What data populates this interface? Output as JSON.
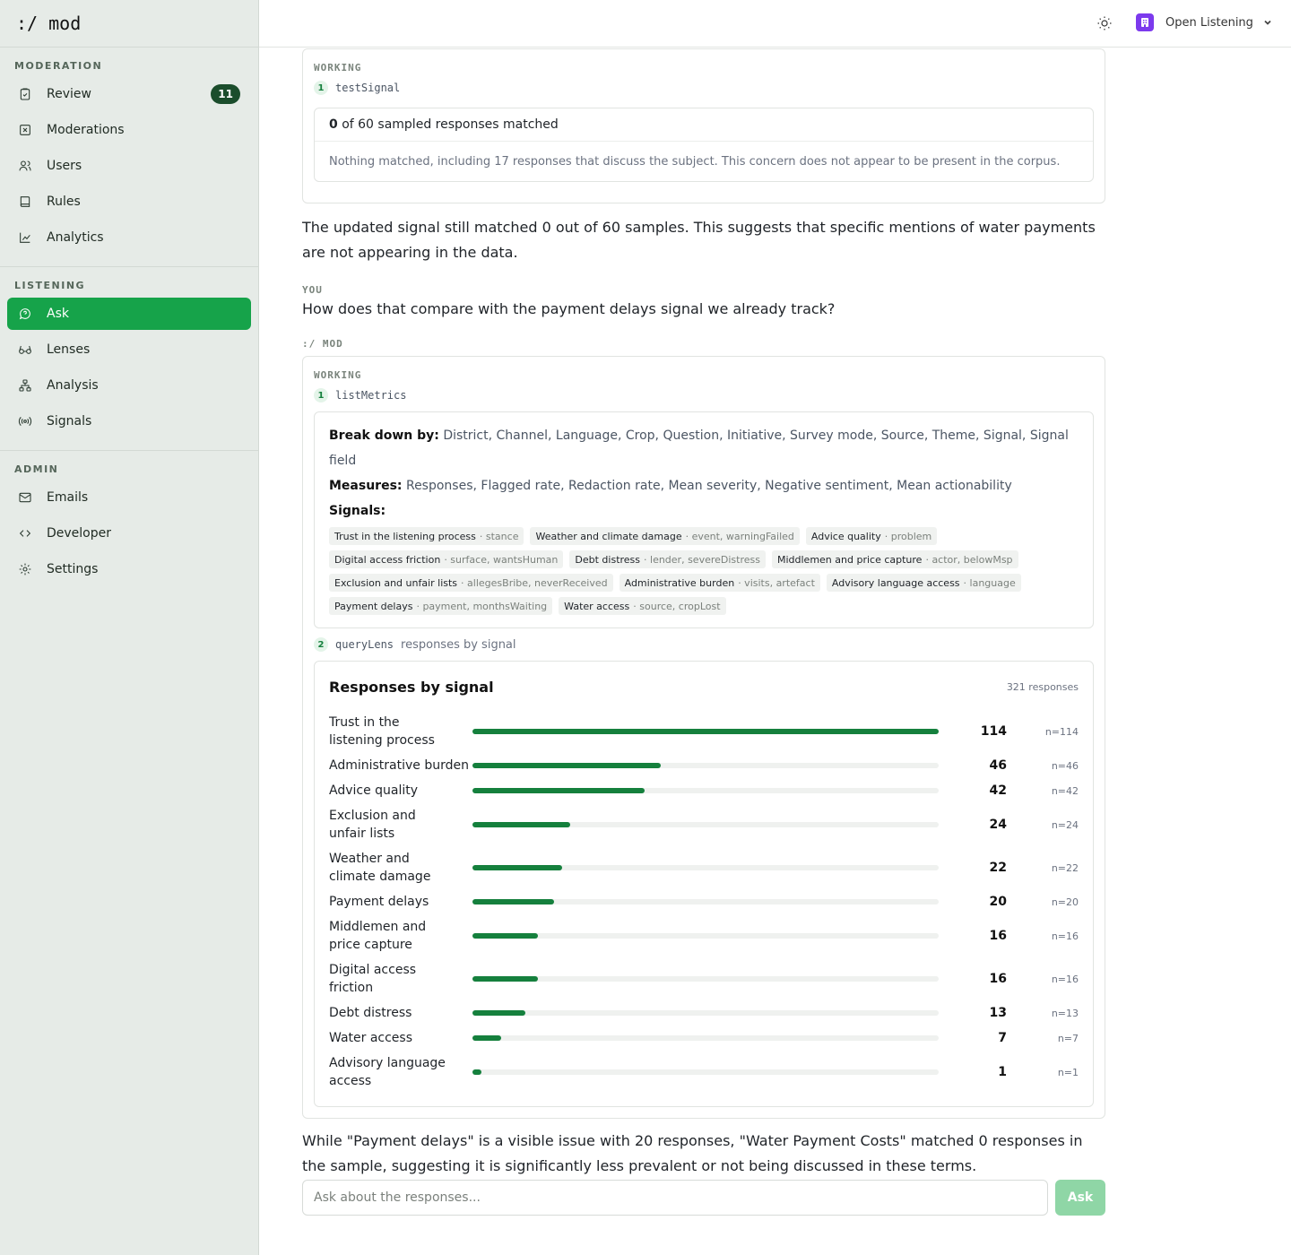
{
  "brand": ":/ mod",
  "sidebar": {
    "sections": [
      {
        "label": "MODERATION",
        "items": [
          {
            "label": "Review",
            "icon": "clipboard-check-icon",
            "badge": "11"
          },
          {
            "label": "Moderations",
            "icon": "flag-icon"
          },
          {
            "label": "Users",
            "icon": "users-icon"
          },
          {
            "label": "Rules",
            "icon": "book-icon"
          },
          {
            "label": "Analytics",
            "icon": "chart-line-icon"
          }
        ]
      },
      {
        "label": "LISTENING",
        "items": [
          {
            "label": "Ask",
            "icon": "chat-bubble-icon",
            "active": true
          },
          {
            "label": "Lenses",
            "icon": "glasses-icon"
          },
          {
            "label": "Analysis",
            "icon": "network-icon"
          },
          {
            "label": "Signals",
            "icon": "radio-signal-icon"
          }
        ]
      },
      {
        "label": "ADMIN",
        "items": [
          {
            "label": "Emails",
            "icon": "mail-icon"
          },
          {
            "label": "Developer",
            "icon": "code-icon"
          },
          {
            "label": "Settings",
            "icon": "gear-icon"
          }
        ]
      }
    ]
  },
  "topbar": {
    "org_name": "Open Listening"
  },
  "thread": {
    "block1": {
      "working_label": "WORKING",
      "step": {
        "num": "1",
        "tool": "testSignal"
      },
      "result_count": "0",
      "result_text": "of 60 sampled responses matched",
      "result_note": "Nothing matched, including 17 responses that discuss the subject. This concern does not appear to be present in the corpus."
    },
    "assistant_text_1": "The updated signal still matched 0 out of 60 samples. This suggests that specific mentions of water payments are not appearing in the data.",
    "user_role": "YOU",
    "user_message": "How does that compare with the payment delays signal we already track?",
    "assistant_role": ":/ MOD",
    "block2": {
      "working_label": "WORKING",
      "step1": {
        "num": "1",
        "tool": "listMetrics"
      },
      "breakdown_label": "Break down by:",
      "breakdown_values": "District, Channel, Language, Crop, Question, Initiative, Survey mode, Source, Theme, Signal, Signal field",
      "measures_label": "Measures:",
      "measures_values": "Responses, Flagged rate, Redaction rate, Mean severity, Negative sentiment, Mean actionability",
      "signals_label": "Signals:",
      "signal_chips": [
        {
          "name": "Trust in the listening process",
          "fields": "· stance"
        },
        {
          "name": "Weather and climate damage",
          "fields": "· event, warningFailed"
        },
        {
          "name": "Advice quality",
          "fields": "· problem"
        },
        {
          "name": "Digital access friction",
          "fields": "· surface, wantsHuman"
        },
        {
          "name": "Debt distress",
          "fields": "· lender, severeDistress"
        },
        {
          "name": "Middlemen and price capture",
          "fields": "· actor, belowMsp"
        },
        {
          "name": "Exclusion and unfair lists",
          "fields": "· allegesBribe, neverReceived"
        },
        {
          "name": "Administrative burden",
          "fields": "· visits, artefact"
        },
        {
          "name": "Advisory language access",
          "fields": "· language"
        },
        {
          "name": "Payment delays",
          "fields": "· payment, monthsWaiting"
        },
        {
          "name": "Water access",
          "fields": "· source, cropLost"
        }
      ],
      "step2": {
        "num": "2",
        "tool": "queryLens",
        "desc": "responses by signal"
      },
      "chart_title": "Responses by signal",
      "chart_total": "321 responses"
    },
    "assistant_text_2": "While \"Payment delays\" is a visible issue with 20 responses, \"Water Payment Costs\" matched 0 responses in the sample, suggesting it is significantly less prevalent or not being discussed in these terms."
  },
  "chart_data": {
    "type": "bar",
    "title": "Responses by signal",
    "total_label": "321 responses",
    "max": 114,
    "categories": [
      "Trust in the listening process",
      "Administrative burden",
      "Advice quality",
      "Exclusion and unfair lists",
      "Weather and climate damage",
      "Payment delays",
      "Middlemen and price capture",
      "Digital access friction",
      "Debt distress",
      "Water access",
      "Advisory language access"
    ],
    "values": [
      114,
      46,
      42,
      24,
      22,
      20,
      16,
      16,
      13,
      7,
      1
    ],
    "n_labels": [
      "n=114",
      "n=46",
      "n=42",
      "n=24",
      "n=22",
      "n=20",
      "n=16",
      "n=16",
      "n=13",
      "n=7",
      "n=1"
    ],
    "bar_color": "#15803d"
  },
  "composer": {
    "placeholder": "Ask about the responses...",
    "button_label": "Ask"
  },
  "colors": {
    "accent": "#16a34a",
    "badge": "#1b4d2c",
    "org_icon": "#7c3aed"
  }
}
